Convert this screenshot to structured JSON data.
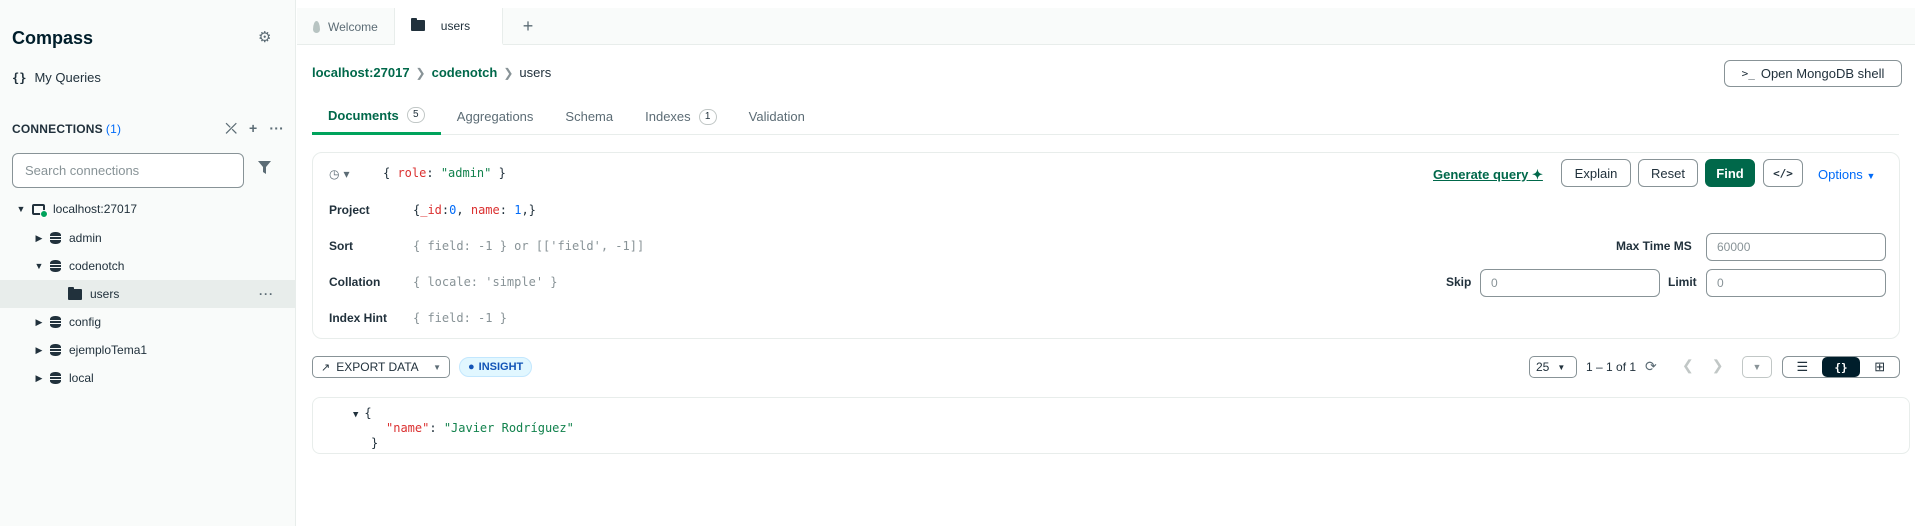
{
  "sidebar": {
    "title": "Compass",
    "my_queries": "My Queries",
    "connections_label": "CONNECTIONS",
    "connections_count": "(1)",
    "search_placeholder": "Search connections",
    "tree": {
      "host": "localhost:27017",
      "dbs": [
        "admin",
        "codenotch",
        "config",
        "ejemploTema1",
        "local"
      ],
      "collection": "users"
    }
  },
  "tabs": {
    "welcome": "Welcome",
    "users": "users"
  },
  "breadcrumb": {
    "host": "localhost:27017",
    "db": "codenotch",
    "collection": "users"
  },
  "shell_button": "Open MongoDB shell",
  "subtabs": {
    "documents": "Documents",
    "documents_count": "5",
    "aggregations": "Aggregations",
    "schema": "Schema",
    "indexes": "Indexes",
    "indexes_count": "1",
    "validation": "Validation"
  },
  "query": {
    "filter": {
      "open": "{ ",
      "key": "role",
      "colon": ": ",
      "value": "\"admin\"",
      "close": " }"
    },
    "project_label": "Project",
    "project": {
      "open": "{",
      "k1": "_id",
      "c1": ":",
      "v1": "0",
      "sep": ", ",
      "k2": "name",
      "c2": ": ",
      "v2": "1",
      "close": ",}"
    },
    "sort_label": "Sort",
    "sort_placeholder": "{ field: -1 } or [['field', -1]]",
    "collation_label": "Collation",
    "collation_placeholder": "{ locale: 'simple' }",
    "index_hint_label": "Index Hint",
    "index_hint_placeholder": "{ field: -1 }",
    "generate_query": "Generate query",
    "explain": "Explain",
    "reset": "Reset",
    "find": "Find",
    "options": "Options",
    "max_time_label": "Max Time MS",
    "max_time_placeholder": "60000",
    "skip_label": "Skip",
    "skip_placeholder": "0",
    "limit_label": "Limit",
    "limit_placeholder": "0"
  },
  "results": {
    "export_label": "EXPORT DATA",
    "insight_label": "INSIGHT",
    "page_size": "25",
    "range": "1 – 1 of 1"
  },
  "document": {
    "open": "{",
    "key": "\"name\"",
    "colon": ": ",
    "value": "\"Javier Rodríguez\"",
    "close": "}"
  }
}
